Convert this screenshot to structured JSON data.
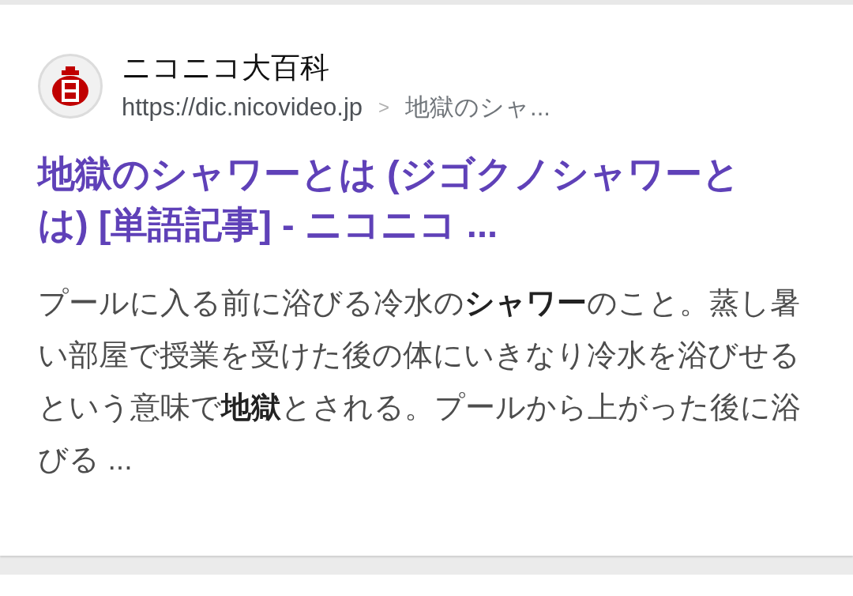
{
  "result": {
    "site_name": "ニコニコ大百科",
    "url": "https://dic.nicovideo.jp",
    "separator": ">",
    "breadcrumb": "地獄のシャ...",
    "title": "地獄のシャワーとは (ジゴクノシャワーとは) [単語記事] - ニコニコ ...",
    "snippet": "プールに入る前に浴びる冷水の**シャワー**のこと。蒸し暑い部屋で授業を受けた後の体にいきなり冷水を浴びせるという意味で**地獄**とされる。プールから上がった後に浴びる ..."
  }
}
